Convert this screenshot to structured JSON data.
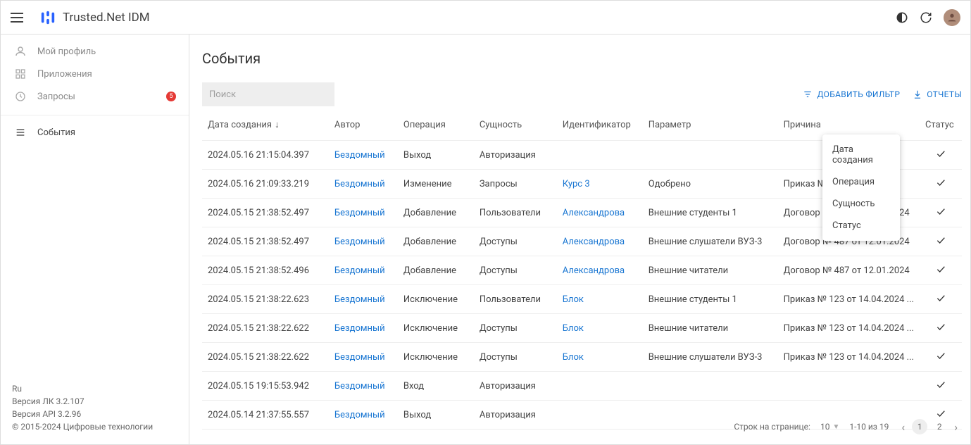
{
  "header": {
    "title": "Trusted.Net IDM"
  },
  "sidebar": {
    "items": [
      {
        "label": "Мой профиль"
      },
      {
        "label": "Приложения"
      },
      {
        "label": "Запросы",
        "badge": "5"
      }
    ],
    "section2": [
      {
        "label": "События"
      }
    ]
  },
  "footer": {
    "lang": "Ru",
    "lk": "Версия ЛК 3.2.107",
    "api": "Версия API 3.2.96",
    "copyright": "© 2015-2024 Цифровые технологии"
  },
  "page": {
    "title": "События",
    "search_placeholder": "Поиск"
  },
  "toolbar": {
    "add_filter": "ДОБАВИТЬ ФИЛЬТР",
    "reports": "ОТЧЕТЫ"
  },
  "filter_menu": [
    "Дата создания",
    "Операция",
    "Сущность",
    "Статус"
  ],
  "table": {
    "headers": {
      "date": "Дата создания",
      "author": "Автор",
      "operation": "Операция",
      "entity": "Сущность",
      "identifier": "Идентификатор",
      "param": "Параметр",
      "reason": "Причина",
      "status": "Статус"
    },
    "rows": [
      {
        "date": "2024.05.16 21:15:04.397",
        "author": "Бездомный",
        "operation": "Выход",
        "entity": "Авторизация",
        "identifier": "",
        "param": "",
        "reason": "",
        "status": true
      },
      {
        "date": "2024.05.16 21:09:33.219",
        "author": "Бездомный",
        "operation": "Изменение",
        "entity": "Запросы",
        "identifier": "Курс 3",
        "param": "Одобрено",
        "reason": "Приказ № ...",
        "status": true
      },
      {
        "date": "2024.05.15 21:38:52.497",
        "author": "Бездомный",
        "operation": "Добавление",
        "entity": "Пользователи",
        "identifier": "Александрова",
        "param": "Внешние студенты 1",
        "reason": "Договор № 487 от 12.01.2024",
        "status": true
      },
      {
        "date": "2024.05.15 21:38:52.497",
        "author": "Бездомный",
        "operation": "Добавление",
        "entity": "Доступы",
        "identifier": "Александрова",
        "param": "Внешние слушатели ВУЗ-3",
        "reason": "Договор № 487 от 12.01.2024",
        "status": true
      },
      {
        "date": "2024.05.15 21:38:52.496",
        "author": "Бездомный",
        "operation": "Добавление",
        "entity": "Доступы",
        "identifier": "Александрова",
        "param": "Внешние читатели",
        "reason": "Договор № 487 от 12.01.2024",
        "status": true
      },
      {
        "date": "2024.05.15 21:38:22.623",
        "author": "Бездомный",
        "operation": "Исключение",
        "entity": "Пользователи",
        "identifier": "Блок",
        "param": "Внешние студенты 1",
        "reason": "Приказ № 123 от 14.04.2024 ...",
        "status": true
      },
      {
        "date": "2024.05.15 21:38:22.622",
        "author": "Бездомный",
        "operation": "Исключение",
        "entity": "Доступы",
        "identifier": "Блок",
        "param": "Внешние читатели",
        "reason": "Приказ № 123 от 14.04.2024 ...",
        "status": true
      },
      {
        "date": "2024.05.15 21:38:22.622",
        "author": "Бездомный",
        "operation": "Исключение",
        "entity": "Доступы",
        "identifier": "Блок",
        "param": "Внешние слушатели ВУЗ-3",
        "reason": "Приказ № 123 от 14.04.2024 ...",
        "status": true
      },
      {
        "date": "2024.05.15 19:15:53.942",
        "author": "Бездомный",
        "operation": "Вход",
        "entity": "Авторизация",
        "identifier": "",
        "param": "",
        "reason": "",
        "status": true
      },
      {
        "date": "2024.05.14 21:37:55.557",
        "author": "Бездомный",
        "operation": "Выход",
        "entity": "Авторизация",
        "identifier": "",
        "param": "",
        "reason": "",
        "status": true
      }
    ]
  },
  "pager": {
    "rows_label": "Строк на странице:",
    "rows_per_page": "10",
    "range": "1-10 из 19",
    "pages": [
      "1",
      "2"
    ],
    "active_page": 0
  }
}
